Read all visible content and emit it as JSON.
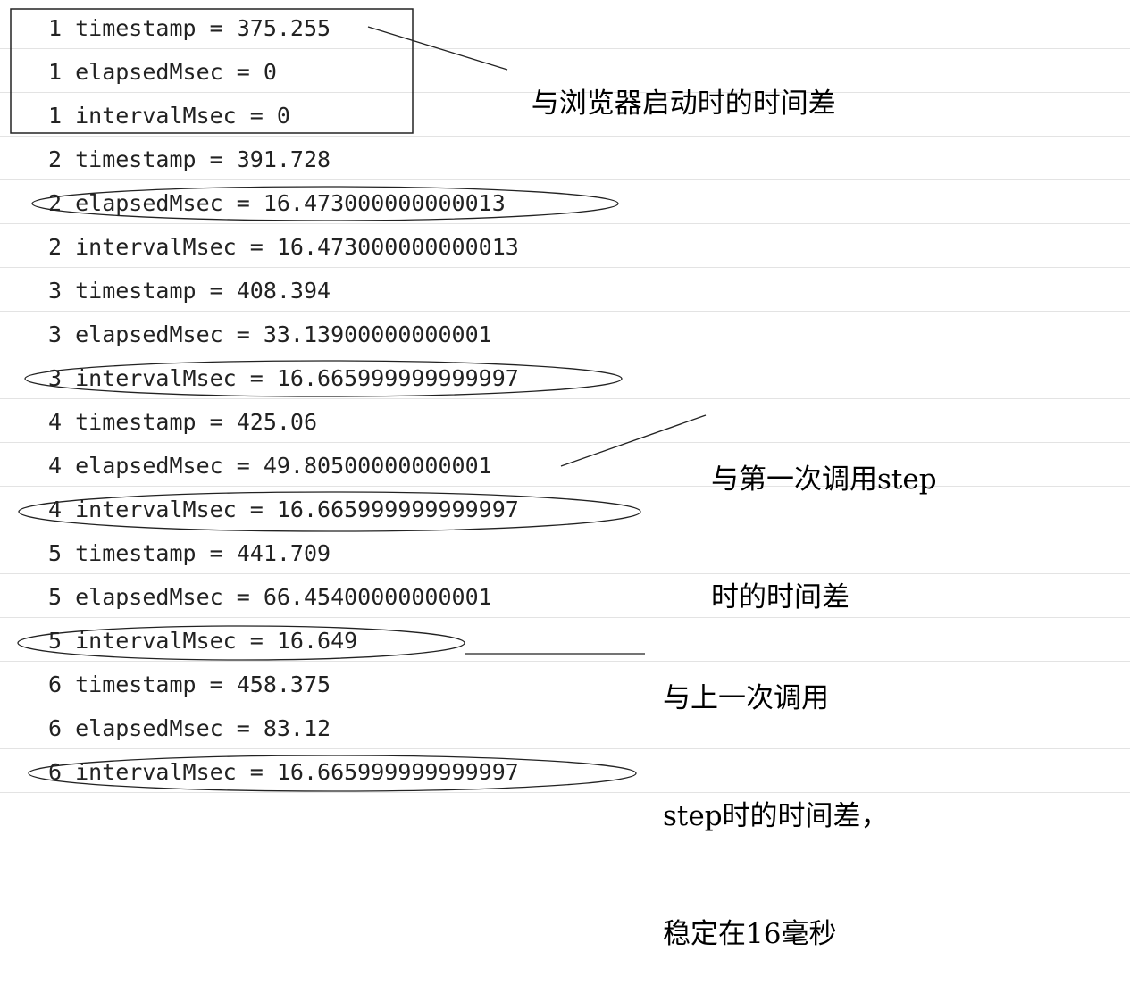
{
  "console": {
    "lines": [
      "1 timestamp = 375.255",
      "1 elapsedMsec = 0",
      "1 intervalMsec = 0",
      "2 timestamp = 391.728",
      "2 elapsedMsec = 16.473000000000013",
      "2 intervalMsec = 16.473000000000013",
      "3 timestamp = 408.394",
      "3 elapsedMsec = 33.13900000000001",
      "3 intervalMsec = 16.665999999999997",
      "4 timestamp = 425.06",
      "4 elapsedMsec = 49.80500000000001",
      "4 intervalMsec = 16.665999999999997",
      "5 timestamp = 441.709",
      "5 elapsedMsec = 66.45400000000001",
      "5 intervalMsec = 16.649",
      "6 timestamp = 458.375",
      "6 elapsedMsec = 83.12",
      "6 intervalMsec = 16.665999999999997"
    ]
  },
  "annotations": {
    "browser_start": "与浏览器启动时的时间差",
    "first_step": [
      "与第一次调用step",
      "时的时间差"
    ],
    "last_step": [
      "与上一次调用",
      "step时的时间差，",
      "稳定在16毫秒"
    ]
  }
}
